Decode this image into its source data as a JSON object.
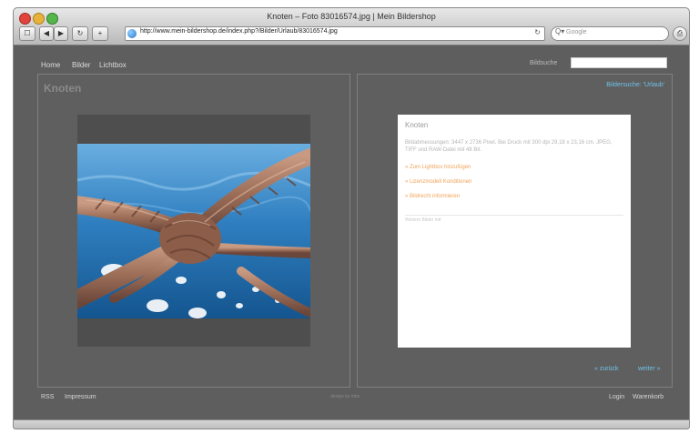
{
  "window": {
    "title": "Knoten – Foto 83016574.jpg | Mein Bildershop"
  },
  "toolbar": {
    "back": "◀",
    "forward": "▶",
    "refresh": "↻",
    "add": "+",
    "url": "http://www.mein-bildershop.de/index.php?/Bilder/Urlaub/83016574.jpg",
    "reload_icon": "↻",
    "search_placeholder": "Google",
    "search_icon": "Q▾",
    "print_icon": "⎙"
  },
  "nav": {
    "home": "Home",
    "bilder": "Bilder",
    "lichtbox": "Lichtbox"
  },
  "search": {
    "label": "Bildsuche"
  },
  "left_panel": {
    "title": "Knoten"
  },
  "right_panel": {
    "top_link": "Bildersuche: 'Urlaub'",
    "card_title": "Knoten",
    "card_text": "Bildabmessungen: 3447 x 2736 Pixel. Bei Druck mit 300 dpi 29,18 x 23,16 cm. JPEG, TIFF und RAW-Datei mit 48 Bit.",
    "link_1": "» Zum Lightbox hinzufügen",
    "link_2": "» Lizenzmodell Konditionen",
    "link_3": "» Bildrecht informieren",
    "small_text": "Weitere Bilder mit",
    "prev": "« zurück",
    "next": "weiter »"
  },
  "footer": {
    "rss": "RSS",
    "impressum": "Impressum",
    "middle": "design by mbs",
    "login": "Login",
    "warenkorb": "Warenkorb"
  },
  "colors": {
    "background": "#5e5e5e",
    "link": "#6fc2e8",
    "accent": "#f0a35a"
  }
}
